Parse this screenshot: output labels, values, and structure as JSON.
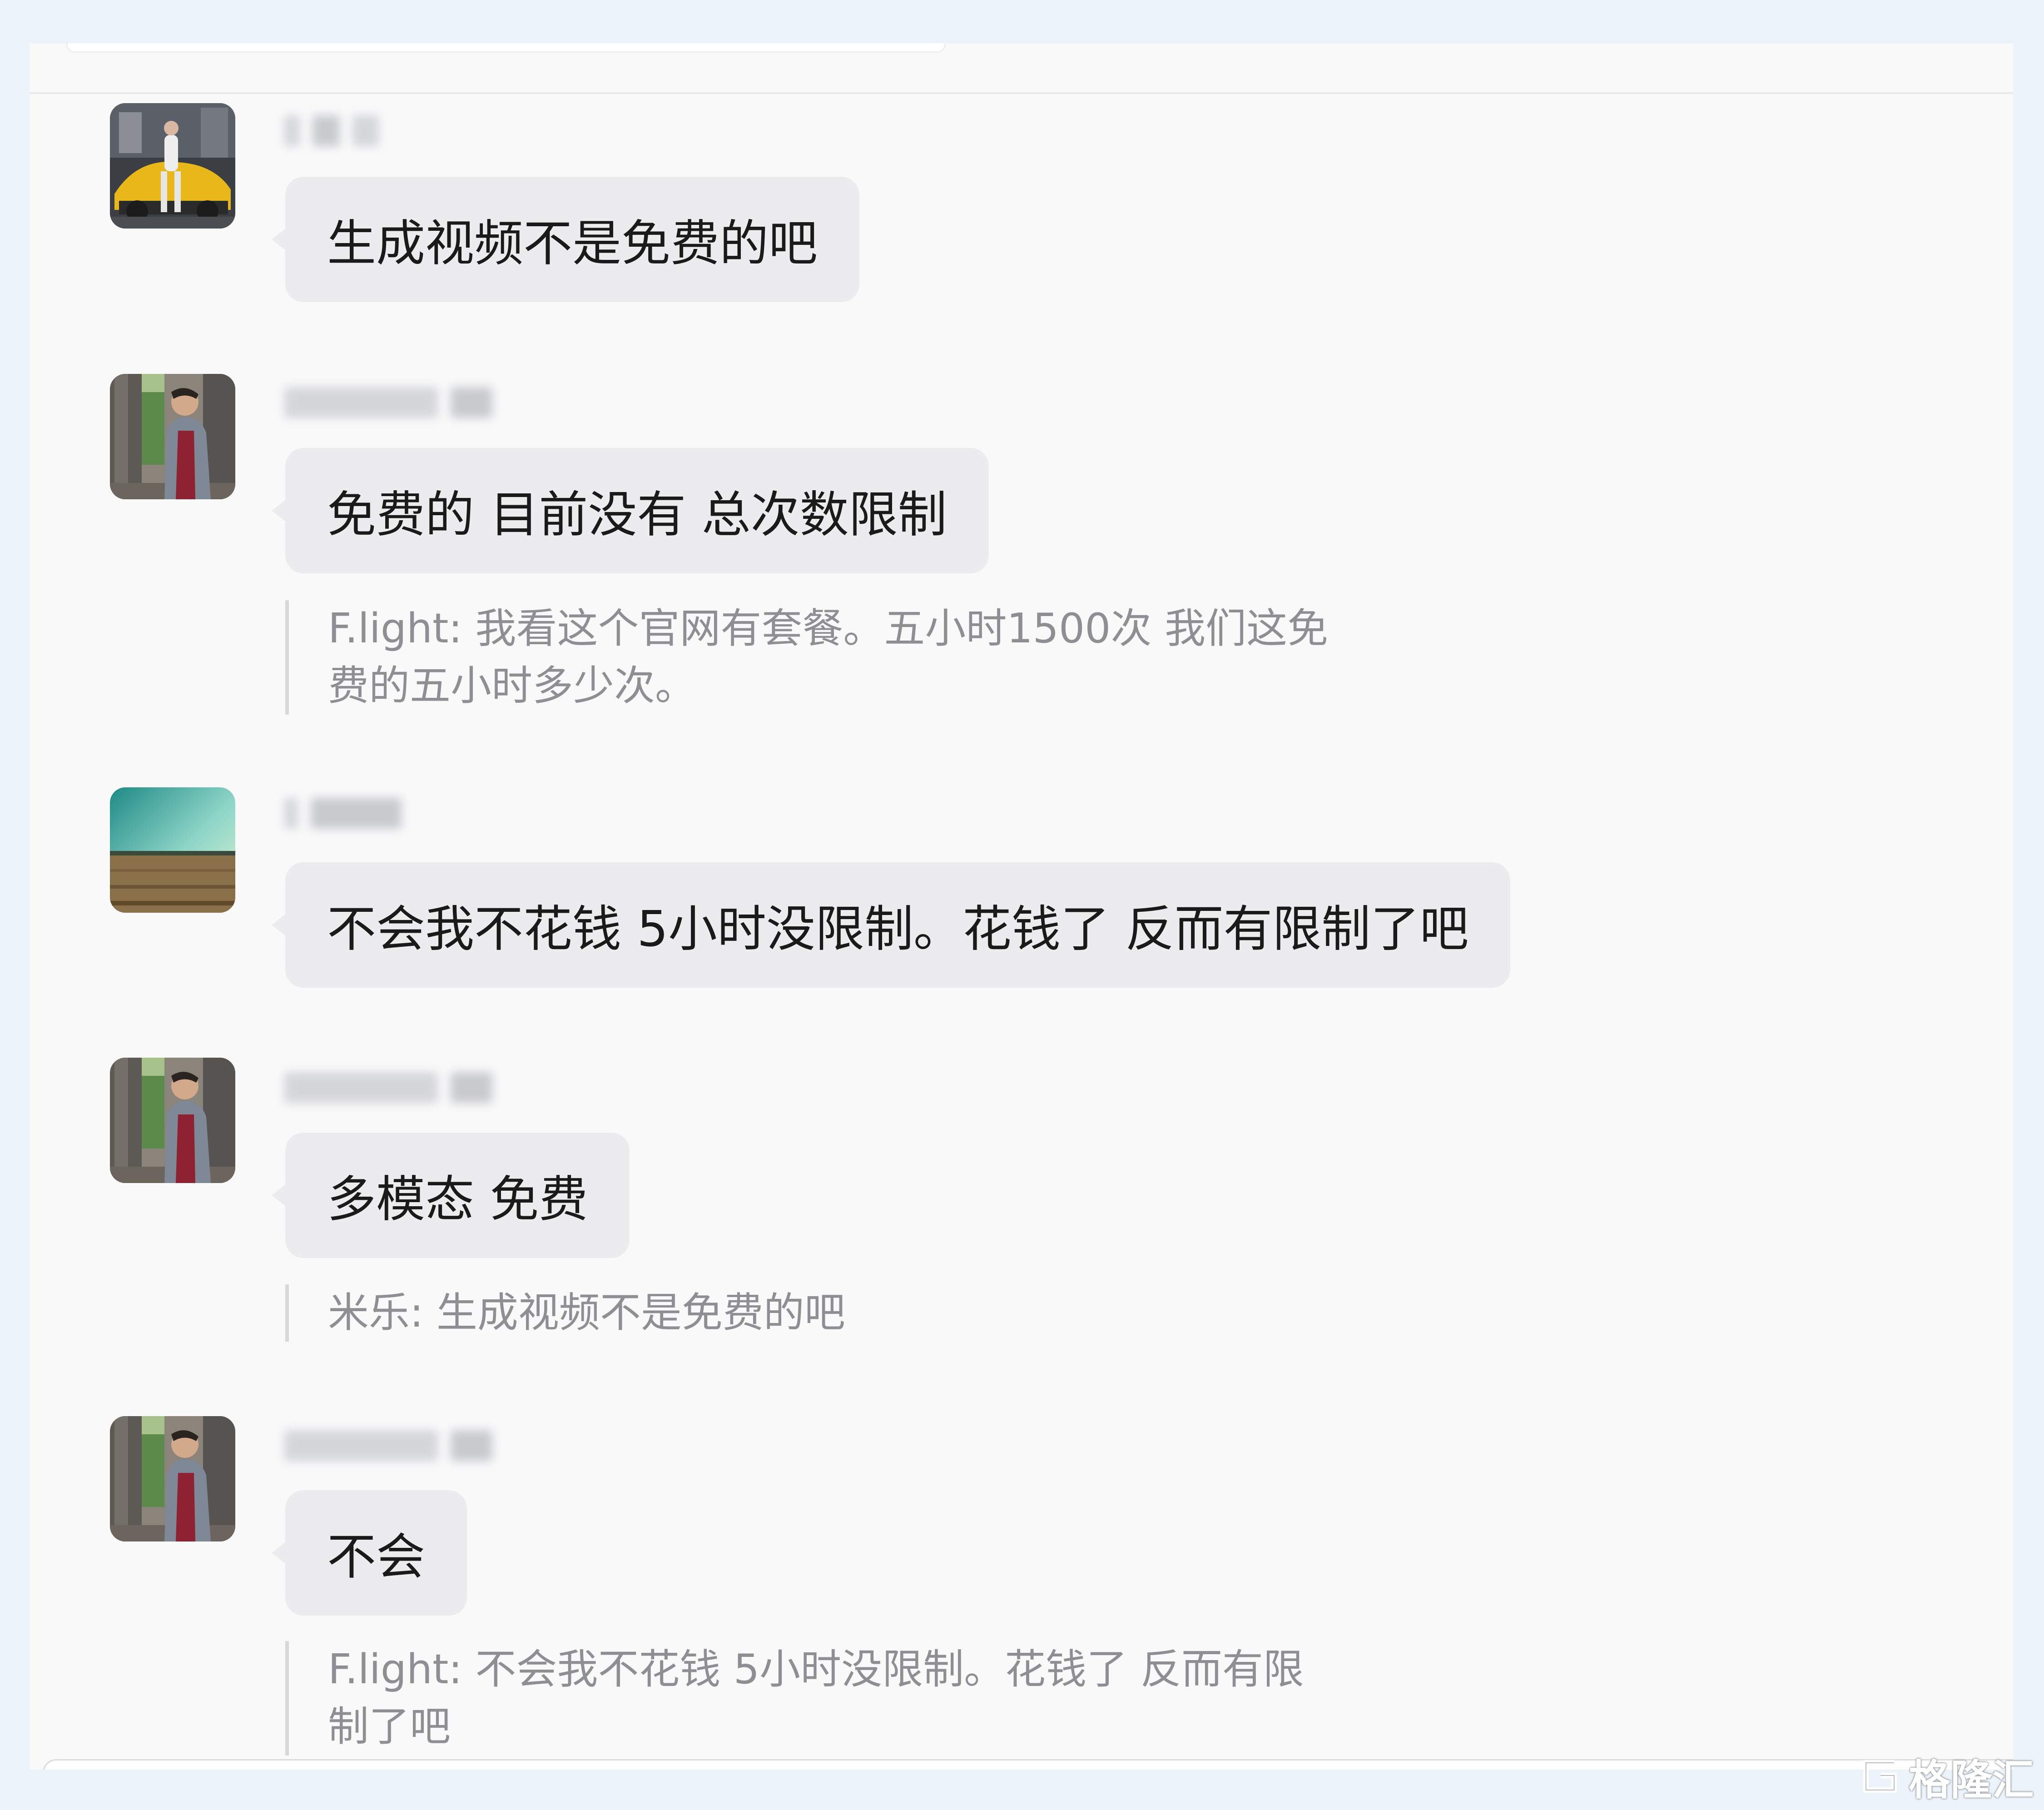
{
  "messages": [
    {
      "sender": "",
      "avatar": "avatar-photo-yellow-car",
      "text": "生成视频不是免费的吧"
    },
    {
      "sender": "",
      "avatar": "avatar-photo-man-arcade",
      "text": "免费的 目前没有 总次数限制",
      "quote_lines": [
        "F.light: 我看这个官网有套餐。五小时1500次 我们这免",
        "费的五小时多少次。"
      ]
    },
    {
      "sender": "",
      "avatar": "avatar-photo-field-landscape",
      "text": "不会我不花钱 5小时没限制。花钱了 反而有限制了吧"
    },
    {
      "sender": "",
      "avatar": "avatar-photo-man-arcade",
      "text": "多模态 免费",
      "quote_lines": [
        "米乐: 生成视频不是免费的吧"
      ]
    },
    {
      "sender": "",
      "avatar": "avatar-photo-man-arcade",
      "text": "不会",
      "quote_lines": [
        "F.light: 不会我不花钱 5小时没限制。花钱了 反而有限",
        "制了吧"
      ]
    }
  ],
  "watermark": {
    "text": "格隆汇",
    "icon": "gelonghui-logo-icon"
  },
  "colors": {
    "page_background": "#edf3fb",
    "chat_background": "#f9f9fa",
    "bubble": "#ececee",
    "quote_text": "#8e8f93"
  }
}
